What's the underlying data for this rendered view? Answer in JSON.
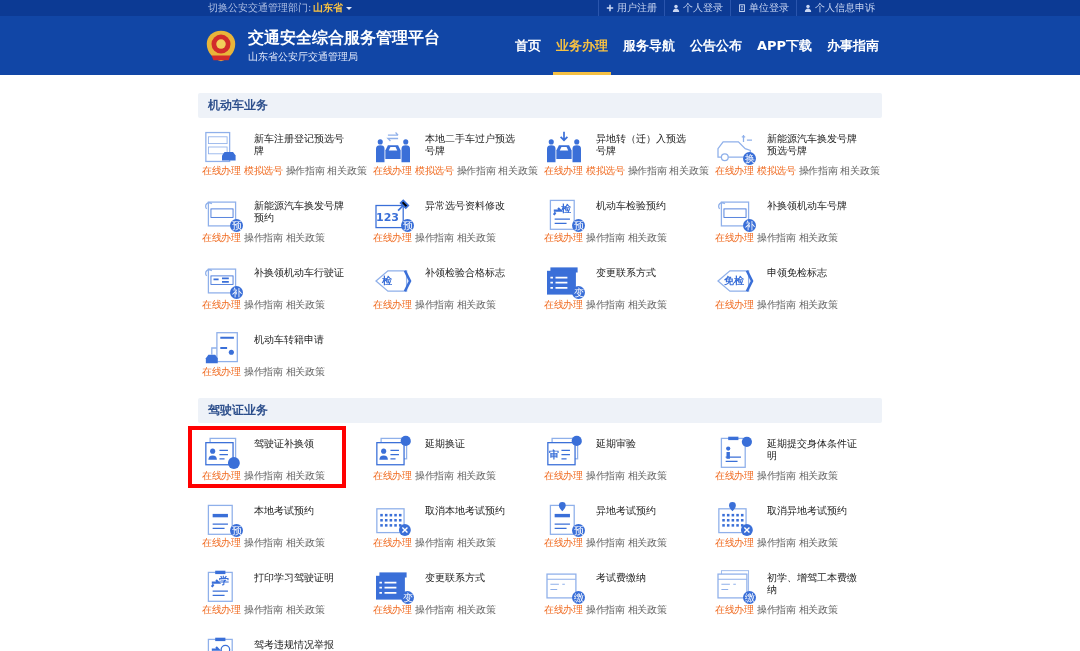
{
  "top_bar": {
    "switch_label": "切换公安交通管理部门:",
    "region": "山东省",
    "links": [
      {
        "label": "用户注册"
      },
      {
        "label": "个人登录"
      },
      {
        "label": "单位登录"
      },
      {
        "label": "个人信息申诉"
      }
    ]
  },
  "header": {
    "title": "交通安全综合服务管理平台",
    "subtitle": "山东省公安厅交通管理局",
    "nav": [
      {
        "label": "首页",
        "selected": false
      },
      {
        "label": "业务办理",
        "selected": true
      },
      {
        "label": "服务导航",
        "selected": false
      },
      {
        "label": "公告公布",
        "selected": false
      },
      {
        "label": "APP下载",
        "selected": false
      },
      {
        "label": "办事指南",
        "selected": false
      }
    ]
  },
  "sections": [
    {
      "title": "机动车业务",
      "items": [
        {
          "title": "新车注册登记预选号牌",
          "highlighted": false,
          "links": [
            {
              "label": "在线办理",
              "kind": "accent"
            },
            {
              "label": "模拟选号",
              "kind": "accent"
            },
            {
              "label": "操作指南",
              "kind": "plain"
            },
            {
              "label": "相关政策",
              "kind": "plain"
            }
          ]
        },
        {
          "title": "本地二手车过户预选号牌",
          "highlighted": false,
          "links": [
            {
              "label": "在线办理",
              "kind": "accent"
            },
            {
              "label": "模拟选号",
              "kind": "accent"
            },
            {
              "label": "操作指南",
              "kind": "plain"
            },
            {
              "label": "相关政策",
              "kind": "plain"
            }
          ]
        },
        {
          "title": "异地转（迁）入预选号牌",
          "highlighted": false,
          "links": [
            {
              "label": "在线办理",
              "kind": "accent"
            },
            {
              "label": "模拟选号",
              "kind": "accent"
            },
            {
              "label": "操作指南",
              "kind": "plain"
            },
            {
              "label": "相关政策",
              "kind": "plain"
            }
          ]
        },
        {
          "title": "新能源汽车换发号牌预选号牌",
          "badge": "换",
          "highlighted": false,
          "links": [
            {
              "label": "在线办理",
              "kind": "accent"
            },
            {
              "label": "模拟选号",
              "kind": "accent"
            },
            {
              "label": "操作指南",
              "kind": "plain"
            },
            {
              "label": "相关政策",
              "kind": "plain"
            }
          ]
        },
        {
          "title": "新能源汽车换发号牌预约",
          "badge": "预",
          "highlighted": false,
          "links": [
            {
              "label": "在线办理",
              "kind": "accent"
            },
            {
              "label": "操作指南",
              "kind": "plain"
            },
            {
              "label": "相关政策",
              "kind": "plain"
            }
          ]
        },
        {
          "title": "异常选号资料修改",
          "mark": "123",
          "badge": "预",
          "highlighted": false,
          "links": [
            {
              "label": "在线办理",
              "kind": "accent"
            },
            {
              "label": "操作指南",
              "kind": "plain"
            },
            {
              "label": "相关政策",
              "kind": "plain"
            }
          ]
        },
        {
          "title": "机动车检验预约",
          "mark": "检",
          "badge": "预",
          "highlighted": false,
          "links": [
            {
              "label": "在线办理",
              "kind": "accent"
            },
            {
              "label": "操作指南",
              "kind": "plain"
            },
            {
              "label": "相关政策",
              "kind": "plain"
            }
          ]
        },
        {
          "title": "补换领机动车号牌",
          "badge": "补",
          "highlighted": false,
          "links": [
            {
              "label": "在线办理",
              "kind": "accent"
            },
            {
              "label": "操作指南",
              "kind": "plain"
            },
            {
              "label": "相关政策",
              "kind": "plain"
            }
          ]
        },
        {
          "title": "补换领机动车行驶证",
          "badge": "补",
          "highlighted": false,
          "links": [
            {
              "label": "在线办理",
              "kind": "accent"
            },
            {
              "label": "操作指南",
              "kind": "plain"
            },
            {
              "label": "相关政策",
              "kind": "plain"
            }
          ]
        },
        {
          "title": "补领检验合格标志",
          "mark": "检",
          "highlighted": false,
          "links": [
            {
              "label": "在线办理",
              "kind": "accent"
            },
            {
              "label": "操作指南",
              "kind": "plain"
            },
            {
              "label": "相关政策",
              "kind": "plain"
            }
          ]
        },
        {
          "title": "变更联系方式",
          "badge": "变",
          "highlighted": false,
          "links": [
            {
              "label": "在线办理",
              "kind": "accent"
            },
            {
              "label": "操作指南",
              "kind": "plain"
            },
            {
              "label": "相关政策",
              "kind": "plain"
            }
          ]
        },
        {
          "title": "申领免检标志",
          "mark": "免检",
          "highlighted": false,
          "links": [
            {
              "label": "在线办理",
              "kind": "accent"
            },
            {
              "label": "操作指南",
              "kind": "plain"
            },
            {
              "label": "相关政策",
              "kind": "plain"
            }
          ]
        },
        {
          "title": "机动车转籍申请",
          "highlighted": false,
          "links": [
            {
              "label": "在线办理",
              "kind": "accent"
            },
            {
              "label": "操作指南",
              "kind": "plain"
            },
            {
              "label": "相关政策",
              "kind": "plain"
            }
          ]
        }
      ]
    },
    {
      "title": "驾驶证业务",
      "items": [
        {
          "title": "驾驶证补换领",
          "highlighted": true,
          "links": [
            {
              "label": "在线办理",
              "kind": "accent"
            },
            {
              "label": "操作指南",
              "kind": "plain"
            },
            {
              "label": "相关政策",
              "kind": "plain"
            }
          ]
        },
        {
          "title": "延期换证",
          "highlighted": false,
          "links": [
            {
              "label": "在线办理",
              "kind": "accent"
            },
            {
              "label": "操作指南",
              "kind": "plain"
            },
            {
              "label": "相关政策",
              "kind": "plain"
            }
          ]
        },
        {
          "title": "延期审验",
          "mark": "审",
          "highlighted": false,
          "links": [
            {
              "label": "在线办理",
              "kind": "accent"
            },
            {
              "label": "操作指南",
              "kind": "plain"
            },
            {
              "label": "相关政策",
              "kind": "plain"
            }
          ]
        },
        {
          "title": "延期提交身体条件证明",
          "highlighted": false,
          "links": [
            {
              "label": "在线办理",
              "kind": "accent"
            },
            {
              "label": "操作指南",
              "kind": "plain"
            },
            {
              "label": "相关政策",
              "kind": "plain"
            }
          ]
        },
        {
          "title": "本地考试预约",
          "badge": "预",
          "highlighted": false,
          "links": [
            {
              "label": "在线办理",
              "kind": "accent"
            },
            {
              "label": "操作指南",
              "kind": "plain"
            },
            {
              "label": "相关政策",
              "kind": "plain"
            }
          ]
        },
        {
          "title": "取消本地考试预约",
          "highlighted": false,
          "links": [
            {
              "label": "在线办理",
              "kind": "accent"
            },
            {
              "label": "操作指南",
              "kind": "plain"
            },
            {
              "label": "相关政策",
              "kind": "plain"
            }
          ]
        },
        {
          "title": "异地考试预约",
          "badge": "预",
          "highlighted": false,
          "links": [
            {
              "label": "在线办理",
              "kind": "accent"
            },
            {
              "label": "操作指南",
              "kind": "plain"
            },
            {
              "label": "相关政策",
              "kind": "plain"
            }
          ]
        },
        {
          "title": "取消异地考试预约",
          "highlighted": false,
          "links": [
            {
              "label": "在线办理",
              "kind": "accent"
            },
            {
              "label": "操作指南",
              "kind": "plain"
            },
            {
              "label": "相关政策",
              "kind": "plain"
            }
          ]
        },
        {
          "title": "打印学习驾驶证明",
          "mark": "学",
          "highlighted": false,
          "links": [
            {
              "label": "在线办理",
              "kind": "accent"
            },
            {
              "label": "操作指南",
              "kind": "plain"
            },
            {
              "label": "相关政策",
              "kind": "plain"
            }
          ]
        },
        {
          "title": "变更联系方式",
          "badge": "变",
          "highlighted": false,
          "links": [
            {
              "label": "在线办理",
              "kind": "accent"
            },
            {
              "label": "操作指南",
              "kind": "plain"
            },
            {
              "label": "相关政策",
              "kind": "plain"
            }
          ]
        },
        {
          "title": "考试费缴纳",
          "badge": "缴",
          "highlighted": false,
          "links": [
            {
              "label": "在线办理",
              "kind": "accent"
            },
            {
              "label": "操作指南",
              "kind": "plain"
            },
            {
              "label": "相关政策",
              "kind": "plain"
            }
          ]
        },
        {
          "title": "初学、增驾工本费缴纳",
          "badge": "缴",
          "highlighted": false,
          "links": [
            {
              "label": "在线办理",
              "kind": "accent"
            },
            {
              "label": "操作指南",
              "kind": "plain"
            },
            {
              "label": "相关政策",
              "kind": "plain"
            }
          ]
        },
        {
          "title": "驾考违规情况举报",
          "highlighted": false
        }
      ]
    }
  ]
}
